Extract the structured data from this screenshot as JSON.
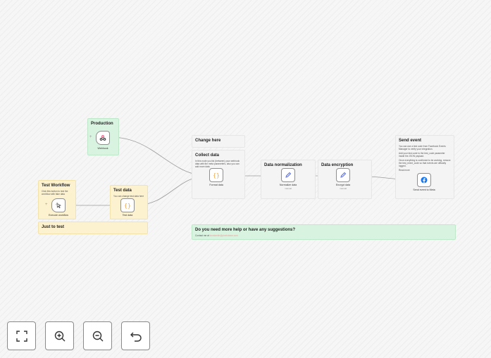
{
  "stickies": {
    "production": {
      "title": "Production"
    },
    "test_workflow": {
      "title": "Test Workflow",
      "body": "Click this button to test the workflow with fake data"
    },
    "test_data": {
      "title": "Test data",
      "body": "You can change test data here"
    },
    "just_to_test": {
      "title": "Just to test"
    },
    "change_here": {
      "title": "Change here"
    },
    "collect_data": {
      "title": "Collect data",
      "body": "In this node you list (between) your webhook data with the meta parameters, also you can add more data"
    },
    "data_normalization": {
      "title": "Data normalization"
    },
    "data_encryption": {
      "title": "Data encryption"
    },
    "send_event": {
      "title": "Send event",
      "body1": "You can use a test code from Facebook Events Manager to verify your integration.",
      "body2": "Add your test code to the test_code parameter inside the JSON payload.",
      "body3": "Once everything is confirmed to be working, remove the test_event_code so that events are officially logged.",
      "link": "Read more"
    },
    "help": {
      "title": "Do you need more help or have any suggestions?",
      "prefix": "Contact me at ",
      "email": "konstantin@pixeloteam.com"
    }
  },
  "nodes": {
    "webhook": {
      "label": "Webhook"
    },
    "execute_workflow": {
      "label": "Execute workflow"
    },
    "test_data": {
      "label": "Test data"
    },
    "format_data": {
      "label": "Format data"
    },
    "normalize_data": {
      "label": "Normalize data",
      "sub": "manual"
    },
    "encrypt_data": {
      "label": "Encrypt data",
      "sub": "manual"
    },
    "send_event": {
      "label": "Send event to Meta"
    }
  },
  "icons": {
    "webhook": "webhook-icon",
    "execute": "cursor-click-icon",
    "code": "code-braces-icon",
    "pencil": "pencil-icon",
    "facebook": "facebook-icon"
  },
  "colors": {
    "sticky_green": "#d8f3df",
    "sticky_yellow": "#fdf2cf",
    "code_orange": "#f4a340",
    "pencil_blue": "#4a5fd8",
    "webhook_red": "#ea4b71",
    "facebook_blue": "#1877f2"
  },
  "controls": [
    "zoom-to-fit",
    "zoom-in",
    "zoom-out",
    "reset-zoom"
  ]
}
